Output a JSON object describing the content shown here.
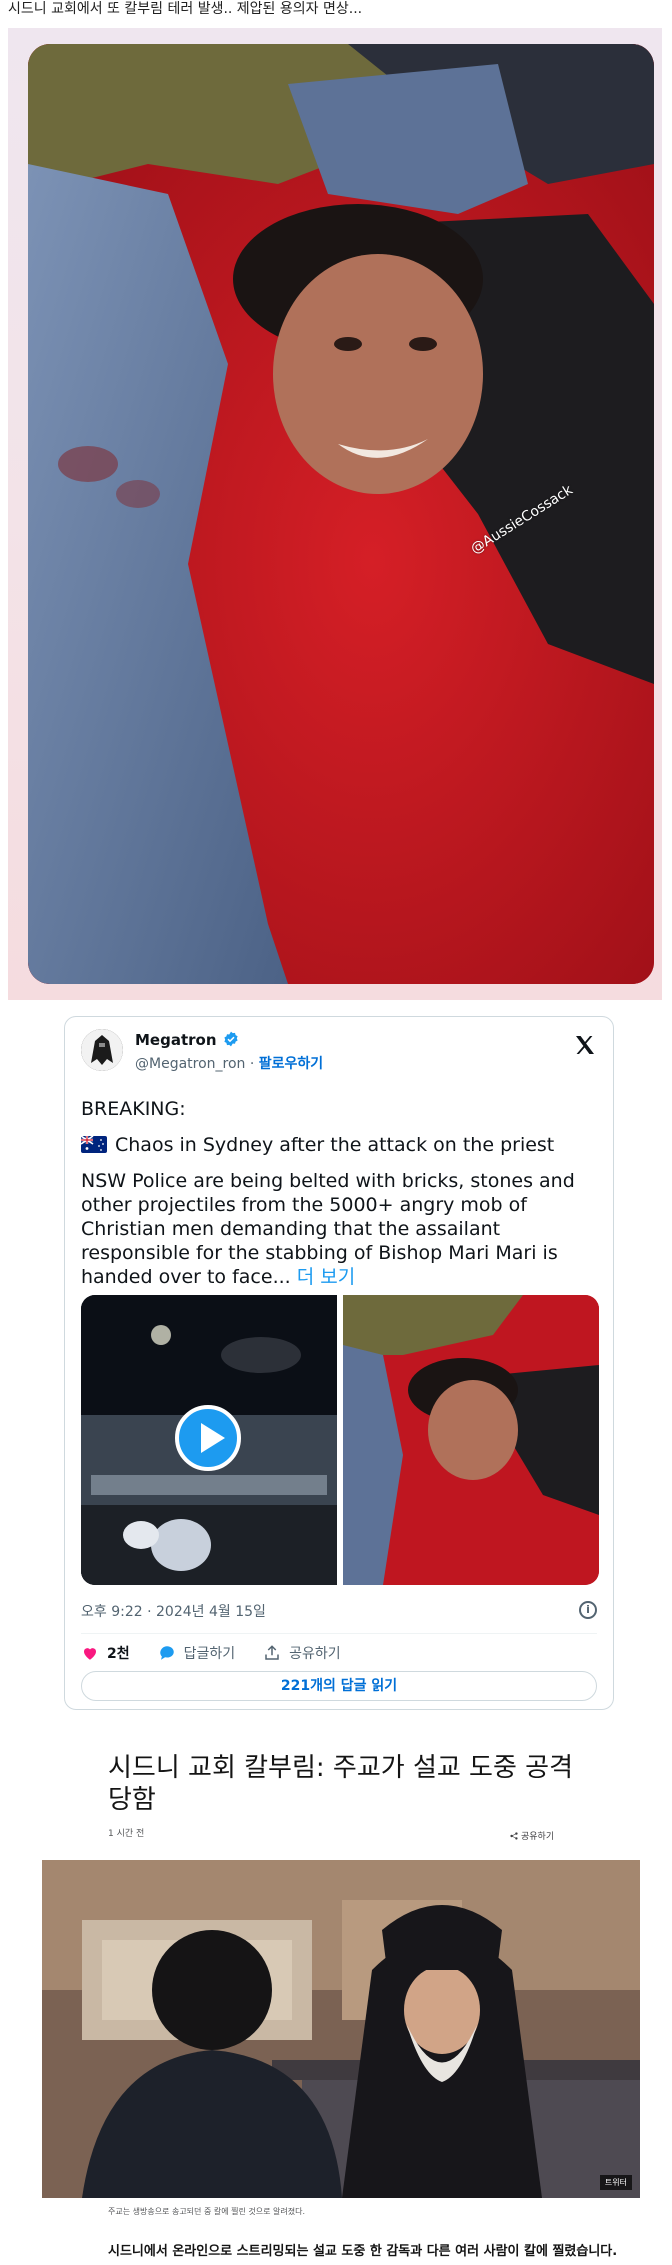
{
  "post": {
    "title": "시드니 교회에서 또 칼부림 테러 발생.. 제압된 용의자 면상..."
  },
  "photo1": {
    "watermark": "@AussieCossack"
  },
  "tweet": {
    "name": "Megatron",
    "handle": "@Megatron_ron",
    "separator": " · ",
    "follow": "팔로우하기",
    "breaking": "BREAKING:",
    "flag_emoji": "australia-flag",
    "line2": "Chaos in Sydney after the attack on the priest",
    "body": "NSW Police are being belted with bricks, stones and other projectiles from the 5000+ angry mob of Christian men demanding that the assailant responsible for the stabbing of Bishop Mari Mari is handed over to face...",
    "more": " 더 보기",
    "time": "오후 9:22 · 2024년 4월 15일",
    "likes": "2천",
    "reply_label": "답글하기",
    "share_label": "공유하기",
    "read_replies": "221개의 답글 읽기",
    "colors": {
      "link": "#006fd6",
      "like": "#f91880",
      "reply": "#1d9bf0"
    }
  },
  "news": {
    "title": "시드니 교회 칼부림: 주교가 설교 도중 공격 당함",
    "time": "1 시간 전",
    "share": "공유하기",
    "credit": "트위터",
    "caption": "주교는 생방송으로 송고되던 중 칼에 찔린 것으로 알려졌다.",
    "body": "시드니에서 온라인으로 스트리밍되는 설교 도중 한 감독과 다른 여러 사람이 칼에 찔렸습니다."
  }
}
